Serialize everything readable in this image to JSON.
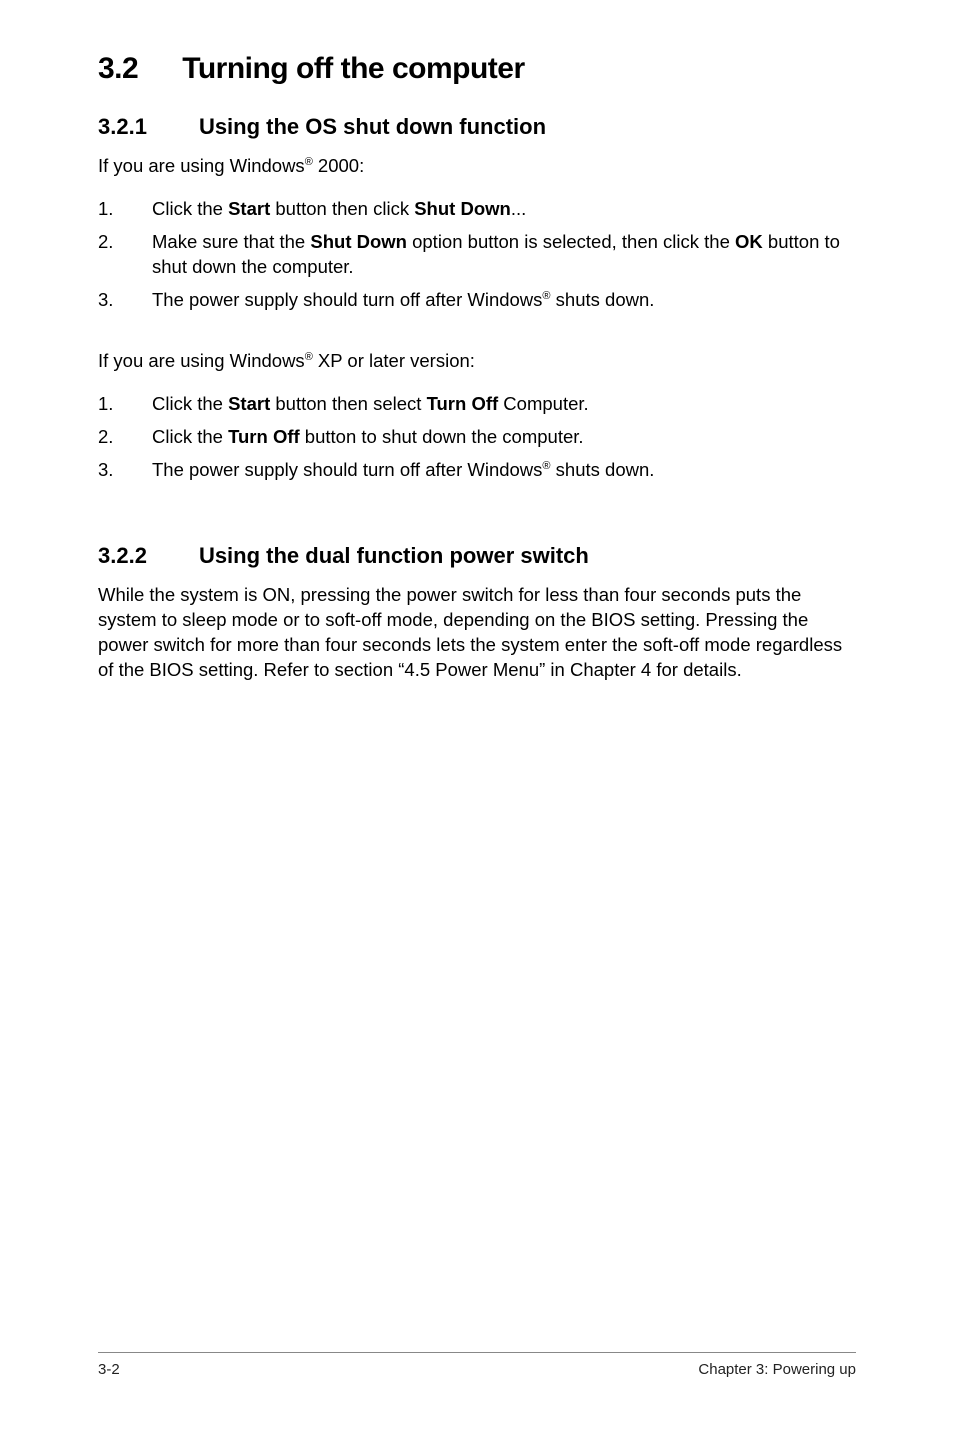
{
  "section": {
    "number": "3.2",
    "title": "Turning off the computer"
  },
  "sub1": {
    "number": "3.2.1",
    "title": "Using the OS shut down function",
    "intro_prefix": "If you are using Windows",
    "intro_suffix": " 2000:",
    "list1": {
      "item1_a": "Click the ",
      "item1_b": "Start",
      "item1_c": " button then click ",
      "item1_d": "Shut Down",
      "item1_e": "...",
      "item2_a": "Make sure that the ",
      "item2_b": "Shut Down",
      "item2_c": " option button is selected, then click the ",
      "item2_d": "OK",
      "item2_e": " button to shut down the computer.",
      "item3_a": "The power supply should turn off after Windows",
      "item3_b": " shuts down."
    },
    "intro2_prefix": "If you are using Windows",
    "intro2_suffix": " XP or later version:",
    "list2": {
      "item1_a": "Click the ",
      "item1_b": "Start",
      "item1_c": " button then select ",
      "item1_d": "Turn Off",
      "item1_e": " Computer.",
      "item2_a": "Click the ",
      "item2_b": "Turn Off",
      "item2_c": " button to shut down the computer.",
      "item3_a": "The power supply should turn off after Windows",
      "item3_b": " shuts down."
    }
  },
  "sub2": {
    "number": "3.2.2",
    "title": "Using the dual function power switch",
    "body": "While the system is ON, pressing the power switch for less than four seconds puts the system to sleep mode or to soft-off mode, depending on the BIOS setting. Pressing the power switch for more than four seconds lets the system enter the soft-off mode regardless of the BIOS setting. Refer to section  “4.5  Power Menu” in Chapter 4 for details."
  },
  "footer": {
    "page": "3-2",
    "chapter": "Chapter 3: Powering up"
  },
  "reg_mark": "®"
}
